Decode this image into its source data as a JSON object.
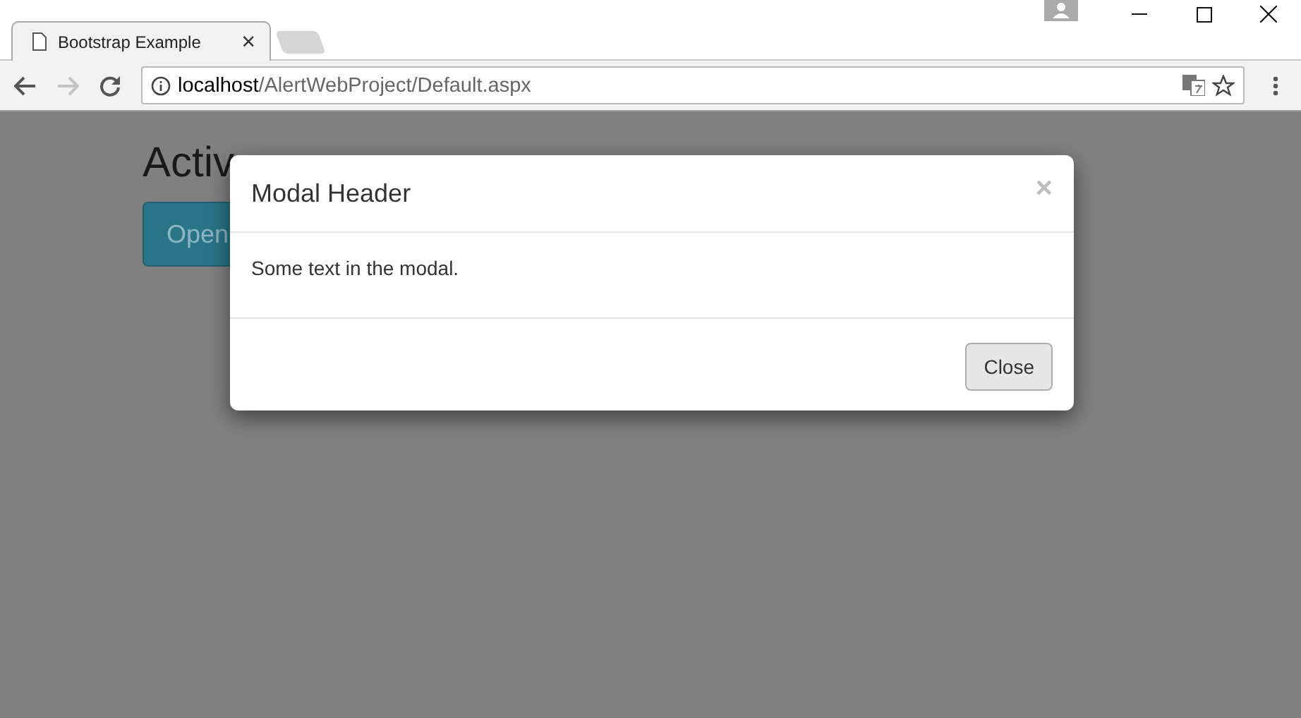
{
  "browser": {
    "tabs": [
      {
        "title": "Bootstrap Example",
        "close": "×",
        "selected": true
      }
    ],
    "address": {
      "host": "localhost",
      "path": "/AlertWebProject/Default.aspx"
    }
  },
  "page": {
    "heading": "Activ",
    "button": "Open"
  },
  "modal": {
    "title": "Modal Header",
    "close_glyph": "×",
    "body": "Some text in the modal.",
    "footer_button": "Close"
  }
}
